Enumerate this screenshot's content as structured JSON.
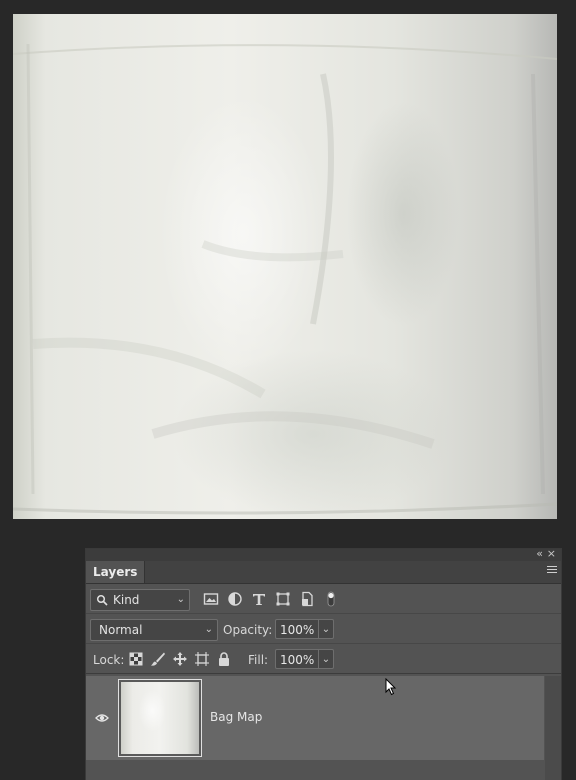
{
  "canvas": {
    "description_icon": "image-canvas"
  },
  "panel": {
    "tab_label": "Layers",
    "collapse_glyph": "«",
    "close_glyph": "×",
    "filter": {
      "kind_label": "Kind",
      "icons": [
        "image-filter-icon",
        "adjustment-filter-icon",
        "type-filter-icon",
        "shape-filter-icon",
        "smart-object-filter-icon",
        "filter-toggle-icon"
      ]
    },
    "blend_mode": "Normal",
    "opacity_label": "Opacity:",
    "opacity_value": "100%",
    "lock_label": "Lock:",
    "fill_label": "Fill:",
    "fill_value": "100%",
    "layers": [
      {
        "name": "Bag Map",
        "visible": true
      }
    ]
  },
  "colors": {
    "panel_bg": "#535353",
    "selected_layer": "#676767",
    "app_bg": "#282828"
  }
}
